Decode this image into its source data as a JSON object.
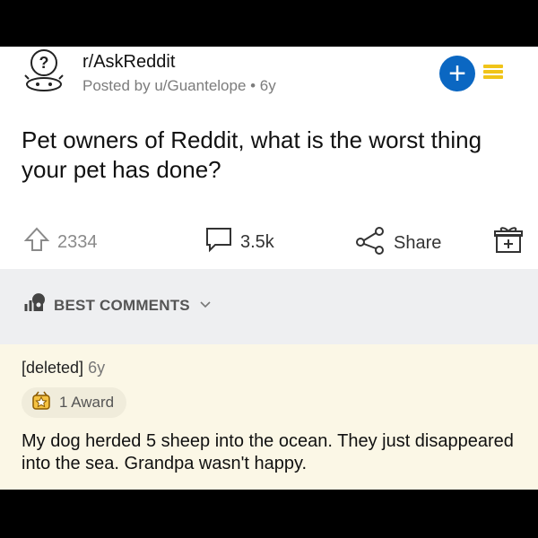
{
  "post": {
    "subreddit": "r/AskReddit",
    "meta": "Posted by u/Guantelope • 6y",
    "title": "Pet owners of Reddit, what is the worst thing your pet has done?",
    "upvotes": "2334",
    "comments": "3.5k",
    "share_label": "Share"
  },
  "sort": {
    "label": "BEST COMMENTS"
  },
  "comment": {
    "author": "[deleted]",
    "age": "6y",
    "award": "1 Award",
    "body": "My dog herded 5 sheep into the ocean. They just disappeared into the sea. Grandpa wasn't happy."
  },
  "colors": {
    "accent_blue": "#0b67c2",
    "menu_gold": "#f0c419",
    "comment_bg": "#fbf7e6",
    "sort_bg": "#eeeff1"
  },
  "icons": [
    "subreddit-icon",
    "plus-icon",
    "menu-icon",
    "upvote-icon",
    "comment-icon",
    "share-icon",
    "gift-icon",
    "sort-icon",
    "chevron-down-icon",
    "award-icon"
  ]
}
